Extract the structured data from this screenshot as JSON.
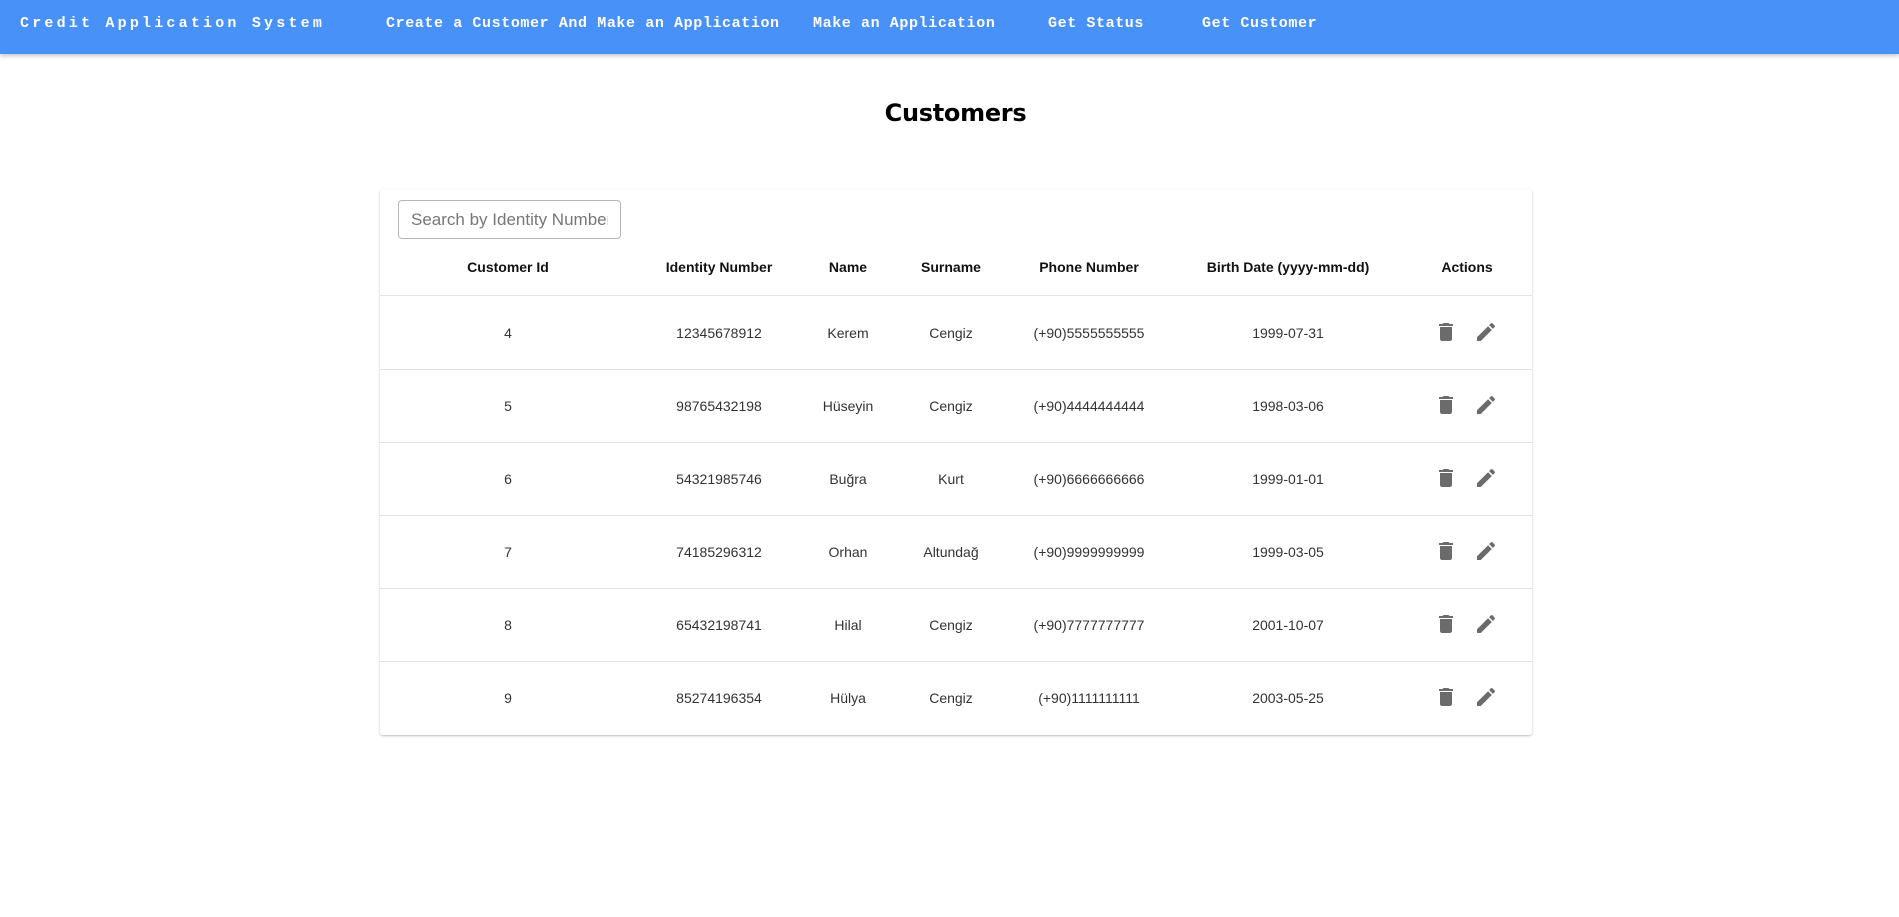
{
  "navbar": {
    "brand": "Credit Application System",
    "links": [
      "Create a Customer And Make an Application",
      "Make an Application",
      "Get Status",
      "Get Customer"
    ]
  },
  "page": {
    "title": "Customers"
  },
  "search": {
    "placeholder": "Search by Identity Number",
    "value": ""
  },
  "table": {
    "headers": [
      "Customer Id",
      "Identity Number",
      "Name",
      "Surname",
      "Phone Number",
      "Birth Date (yyyy-mm-dd)",
      "Actions"
    ],
    "rows": [
      [
        "4",
        "12345678912",
        "Kerem",
        "Cengiz",
        "(+90)5555555555",
        "1999-07-31"
      ],
      [
        "5",
        "98765432198",
        "Hüseyin",
        "Cengiz",
        "(+90)4444444444",
        "1998-03-06"
      ],
      [
        "6",
        "54321985746",
        "Buğra",
        "Kurt",
        "(+90)6666666666",
        "1999-01-01"
      ],
      [
        "7",
        "74185296312",
        "Orhan",
        "Altundağ",
        "(+90)9999999999",
        "1999-03-05"
      ],
      [
        "8",
        "65432198741",
        "Hilal",
        "Cengiz",
        "(+90)7777777777",
        "2001-10-07"
      ],
      [
        "9",
        "85274196354",
        "Hülya",
        "Cengiz",
        "(+90)1111111111",
        "2003-05-25"
      ]
    ],
    "row_actions": [
      "delete-icon",
      "edit-icon"
    ]
  },
  "colors": {
    "navbar": "#4791f8",
    "icon": "#6b6b6b"
  }
}
